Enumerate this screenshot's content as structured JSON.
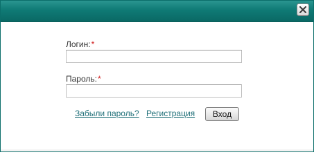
{
  "dialog": {
    "close_icon": "close-icon",
    "accent_color": "#0f7a75"
  },
  "form": {
    "login_label": "Логин:",
    "login_required_mark": "*",
    "login_value": "",
    "password_label": "Пароль:",
    "password_required_mark": "*",
    "password_value": ""
  },
  "links": {
    "forgot_password": "Забыли пароль?",
    "register": "Регистрация"
  },
  "buttons": {
    "submit_label": "Вход"
  }
}
